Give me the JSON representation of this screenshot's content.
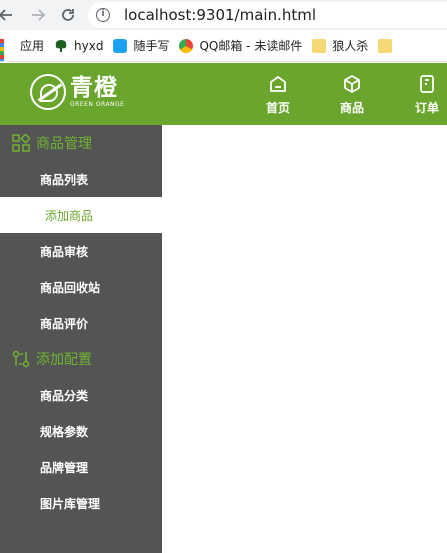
{
  "browser": {
    "url": "localhost:9301/main.html",
    "bookmarks": [
      {
        "label": "应用",
        "icon": "apps-grid-icon"
      },
      {
        "label": "hyxd",
        "icon": "tree-icon"
      },
      {
        "label": "随手写",
        "icon": "bird-icon"
      },
      {
        "label": "QQ邮箱 - 未读邮件",
        "icon": "qq-mail-icon"
      },
      {
        "label": "狼人杀",
        "icon": "folder-icon"
      }
    ]
  },
  "header": {
    "logo_cn": "青橙",
    "logo_en": "GREEN ORANGE",
    "nav": [
      {
        "label": "首页",
        "icon": "home-icon"
      },
      {
        "label": "商品",
        "icon": "cube-icon"
      },
      {
        "label": "订单",
        "icon": "order-icon"
      }
    ]
  },
  "sidebar": {
    "groups": [
      {
        "label": "商品管理",
        "icon": "grid-icon",
        "items": [
          {
            "label": "商品列表",
            "active": false
          },
          {
            "label": "添加商品",
            "active": true
          },
          {
            "label": "商品审核",
            "active": false
          },
          {
            "label": "商品回收站",
            "active": false
          },
          {
            "label": "商品评价",
            "active": false
          }
        ]
      },
      {
        "label": "添加配置",
        "icon": "config-icon",
        "items": [
          {
            "label": "商品分类",
            "active": false
          },
          {
            "label": "规格参数",
            "active": false
          },
          {
            "label": "品牌管理",
            "active": false
          },
          {
            "label": "图片库管理",
            "active": false
          }
        ]
      }
    ]
  },
  "colors": {
    "brand_green": "#6aa52d",
    "sidebar_bg": "#545454",
    "group_label": "#6fb32f"
  }
}
